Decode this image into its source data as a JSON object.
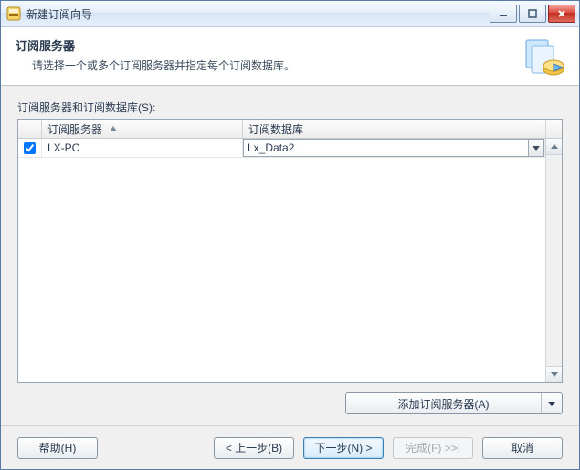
{
  "window": {
    "title": "新建订阅向导"
  },
  "header": {
    "title": "订阅服务器",
    "subtitle": "请选择一个或多个订阅服务器并指定每个订阅数据库。"
  },
  "section_label": "订阅服务器和订阅数据库(S):",
  "grid": {
    "columns": {
      "server": "订阅服务器",
      "database": "订阅数据库"
    },
    "rows": [
      {
        "checked": true,
        "server": "LX-PC",
        "database": "Lx_Data2"
      }
    ]
  },
  "add_server_button": "添加订阅服务器(A)",
  "footer": {
    "help": "帮助(H)",
    "back": "< 上一步(B)",
    "next": "下一步(N) >",
    "finish": "完成(F) >>|",
    "cancel": "取消"
  }
}
